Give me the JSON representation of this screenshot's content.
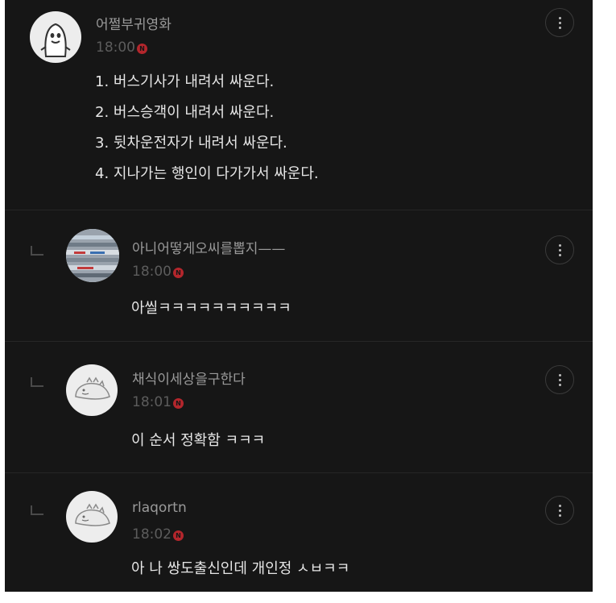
{
  "comments": [
    {
      "author": "어쩔부귀영화",
      "time": "18:00",
      "badge": "N",
      "lines": [
        "1. 버스기사가 내려서 싸운다.",
        "2. 버스승객이 내려서 싸운다.",
        "3. 뒷차운전자가 내려서 싸운다.",
        "4. 지나가는 행인이 다가가서 싸운다."
      ],
      "avatar_icon": "ghost-character-avatar-icon",
      "menu_icon": "more-vertical-icon"
    }
  ],
  "replies": [
    {
      "author": "아니어떻게오씨를뽑지——",
      "time": "18:00",
      "badge": "N",
      "text": "아씰ㅋㅋㅋㅋㅋㅋㅋㅋㅋㅋ",
      "avatar_icon": "striped-photo-avatar-icon",
      "menu_icon": "more-vertical-icon"
    },
    {
      "author": "채식이세상을구한다",
      "time": "18:01",
      "badge": "N",
      "text": "이 순서 정확함 ㅋㅋㅋ",
      "avatar_icon": "dinosaur-avatar-icon",
      "menu_icon": "more-vertical-icon"
    },
    {
      "author": "rlaqortn",
      "time": "18:02",
      "badge": "N",
      "text": "아 나 쌍도출신인데 개인정 ㅅㅂㅋㅋ",
      "avatar_icon": "dinosaur-avatar-icon",
      "menu_icon": "more-vertical-icon"
    }
  ],
  "colors": {
    "background": "#161616",
    "author_text": "#9a9a9a",
    "time_text": "#5c5c5c",
    "body_text": "#e6e6e6",
    "badge": "#b3262c"
  }
}
